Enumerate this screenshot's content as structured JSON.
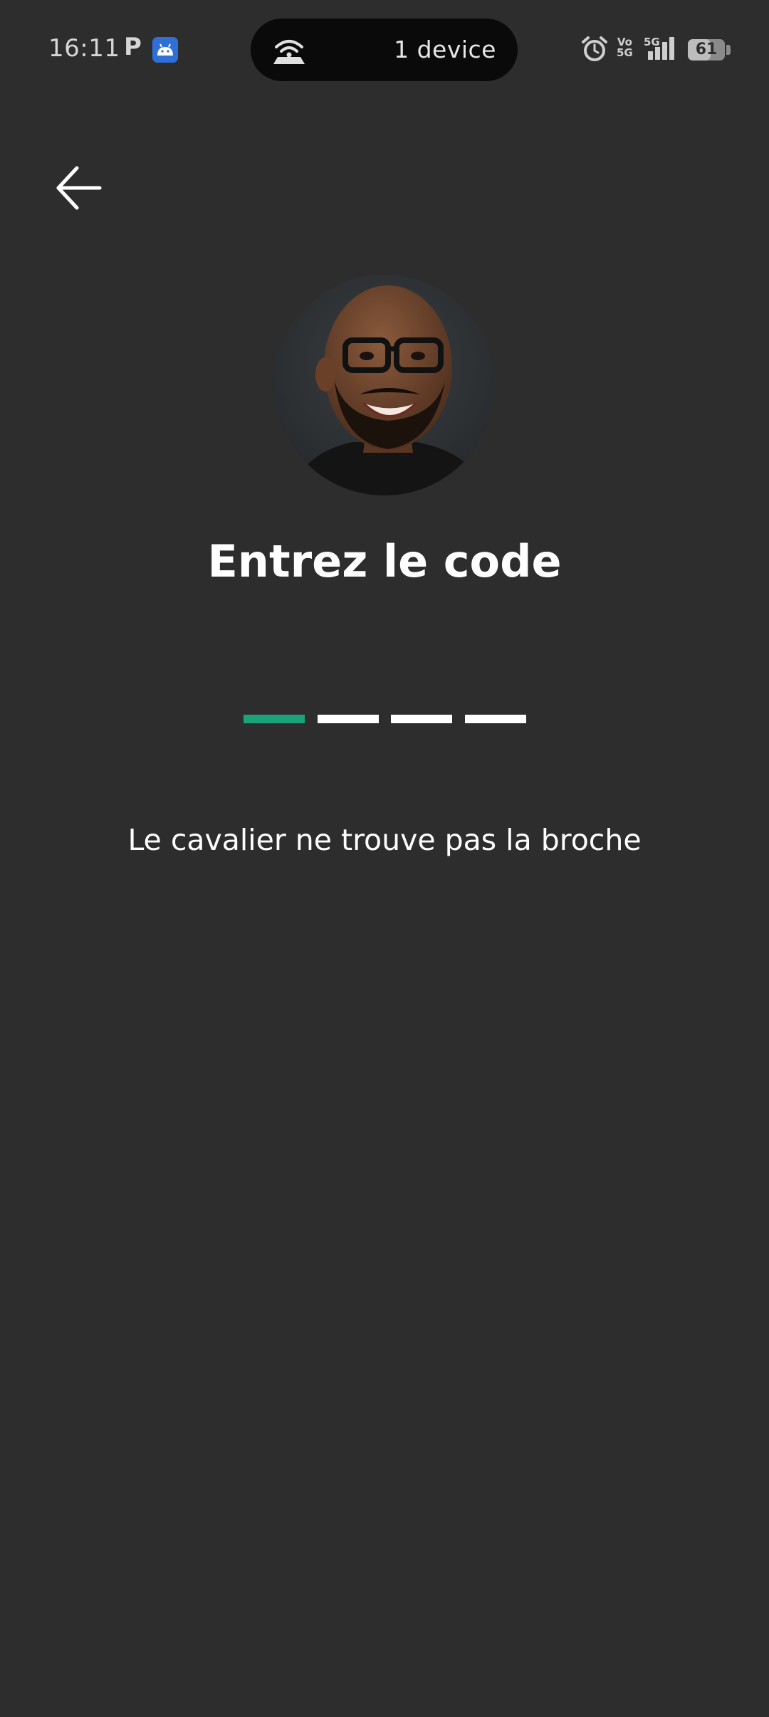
{
  "status_bar": {
    "time": "16:11",
    "notification_letter": "P",
    "hotspot_label": "1 device",
    "battery_level": "61",
    "battery_fraction": 0.61,
    "network_label": "5G",
    "volte_label": "Vo 5G",
    "icons": [
      "parking-app-icon",
      "android-app-icon",
      "hotspot-icon",
      "alarm-icon",
      "volte-icon",
      "signal-icon",
      "battery-icon"
    ]
  },
  "nav": {
    "back_icon": "arrow-left-icon"
  },
  "main": {
    "title": "Entrez le code",
    "pin_slots": [
      {
        "state": "active"
      },
      {
        "state": "empty"
      },
      {
        "state": "empty"
      },
      {
        "state": "empty"
      }
    ],
    "hint": "Le cavalier ne trouve pas la broche"
  },
  "colors": {
    "background": "#2d2d2d",
    "accent": "#1aa37a",
    "text": "#ffffff"
  }
}
